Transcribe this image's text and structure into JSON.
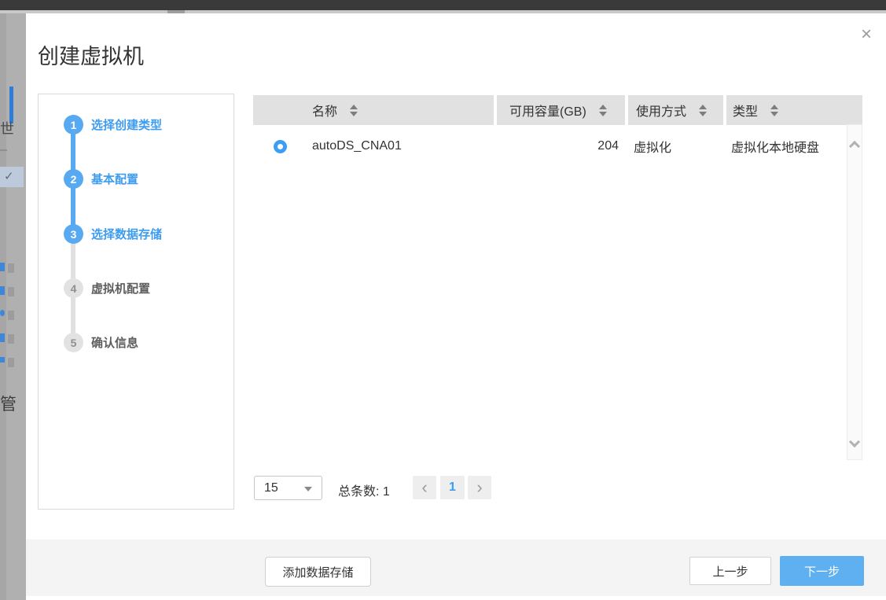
{
  "backdrop": {
    "fragment_char_1": "世",
    "fragment_check": "✓",
    "fragment_char_2": "管"
  },
  "dialog": {
    "title": "创建虚拟机",
    "close_icon": "×"
  },
  "stepper": {
    "steps": [
      {
        "num": "1",
        "label": "选择创建类型",
        "state": "done"
      },
      {
        "num": "2",
        "label": "基本配置",
        "state": "done"
      },
      {
        "num": "3",
        "label": "选择数据存储",
        "state": "active"
      },
      {
        "num": "4",
        "label": "虚拟机配置",
        "state": "pending"
      },
      {
        "num": "5",
        "label": "确认信息",
        "state": "pending"
      }
    ]
  },
  "table": {
    "columns": [
      {
        "label": "名称"
      },
      {
        "label": "可用容量(GB)"
      },
      {
        "label": "使用方式"
      },
      {
        "label": "类型"
      }
    ],
    "rows": [
      {
        "selected": true,
        "name": "autoDS_CNA01",
        "capacity_gb": "204",
        "usage": "虚拟化",
        "type": "虚拟化本地硬盘"
      }
    ]
  },
  "pagination": {
    "page_size": "15",
    "total_label": "总条数: 1",
    "prev_icon": "‹",
    "page": "1",
    "next_icon": "›"
  },
  "footer": {
    "add_datastore_label": "添加数据存储",
    "prev_label": "上一步",
    "next_label": "下一步"
  },
  "colors": {
    "accent_blue": "#57a9f1",
    "step_link_blue": "#3d9cf0",
    "page_number_blue": "#3b9ef5",
    "next_button_blue": "#5fb0f1",
    "table_header_bg": "#e1e1e1",
    "footer_bg": "#f4f4f4",
    "topbar_dark": "#3a3a3a"
  }
}
